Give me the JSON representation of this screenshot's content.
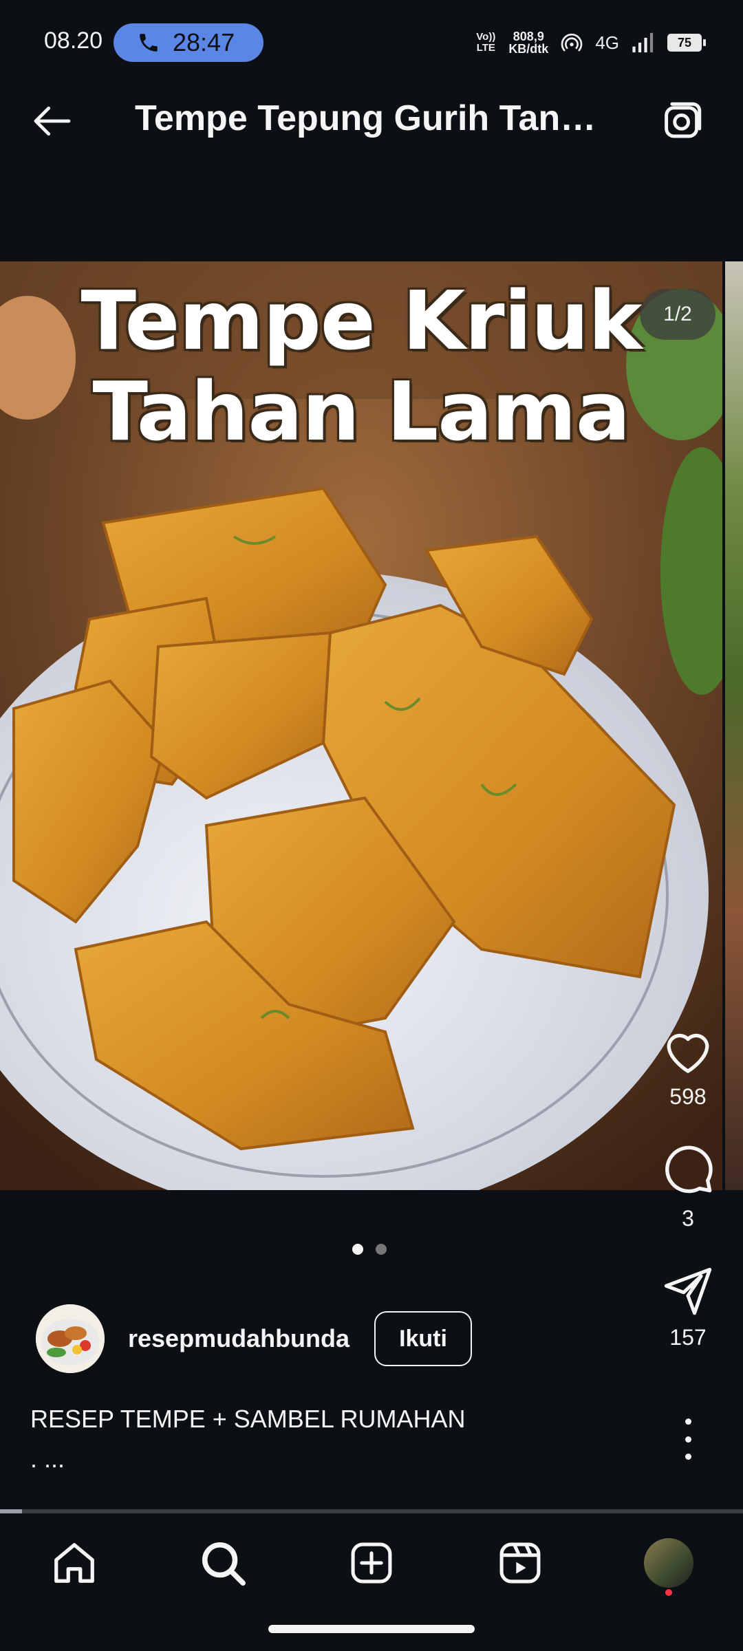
{
  "status": {
    "time": "08.20",
    "call_duration": "28:47",
    "volte": "Vo)) LTE",
    "net_speed": "808,9",
    "net_unit": "KB/dtk",
    "network": "4G",
    "battery": "75"
  },
  "header": {
    "title": "Tempe Tepung Gurih Tanpa Rasa Tepung Yang Mudah Dibuat"
  },
  "post": {
    "image_text_line1": "Tempe Kriuk",
    "image_text_line2": "Tahan Lama",
    "counter": "1/2",
    "likes": "598",
    "comments": "3",
    "shares": "157",
    "author": "resepmudahbunda",
    "follow_label": "Ikuti",
    "caption": "RESEP TEMPE + SAMBEL RUMAHAN",
    "caption_more": ". ...",
    "slides_total": 2,
    "slide_active": 1,
    "progress": 0.03
  },
  "icons": {
    "back": "arrow-left-icon",
    "camera": "camera-icon",
    "like": "heart-icon",
    "comment": "comment-icon",
    "share": "send-icon",
    "more": "more-vertical-icon",
    "nav": [
      "home-icon",
      "search-icon",
      "add-icon",
      "reels-icon",
      "profile-avatar"
    ]
  },
  "colors": {
    "background": "#0c1014",
    "call_pill": "#5b86e5",
    "notification": "#ff3040"
  }
}
